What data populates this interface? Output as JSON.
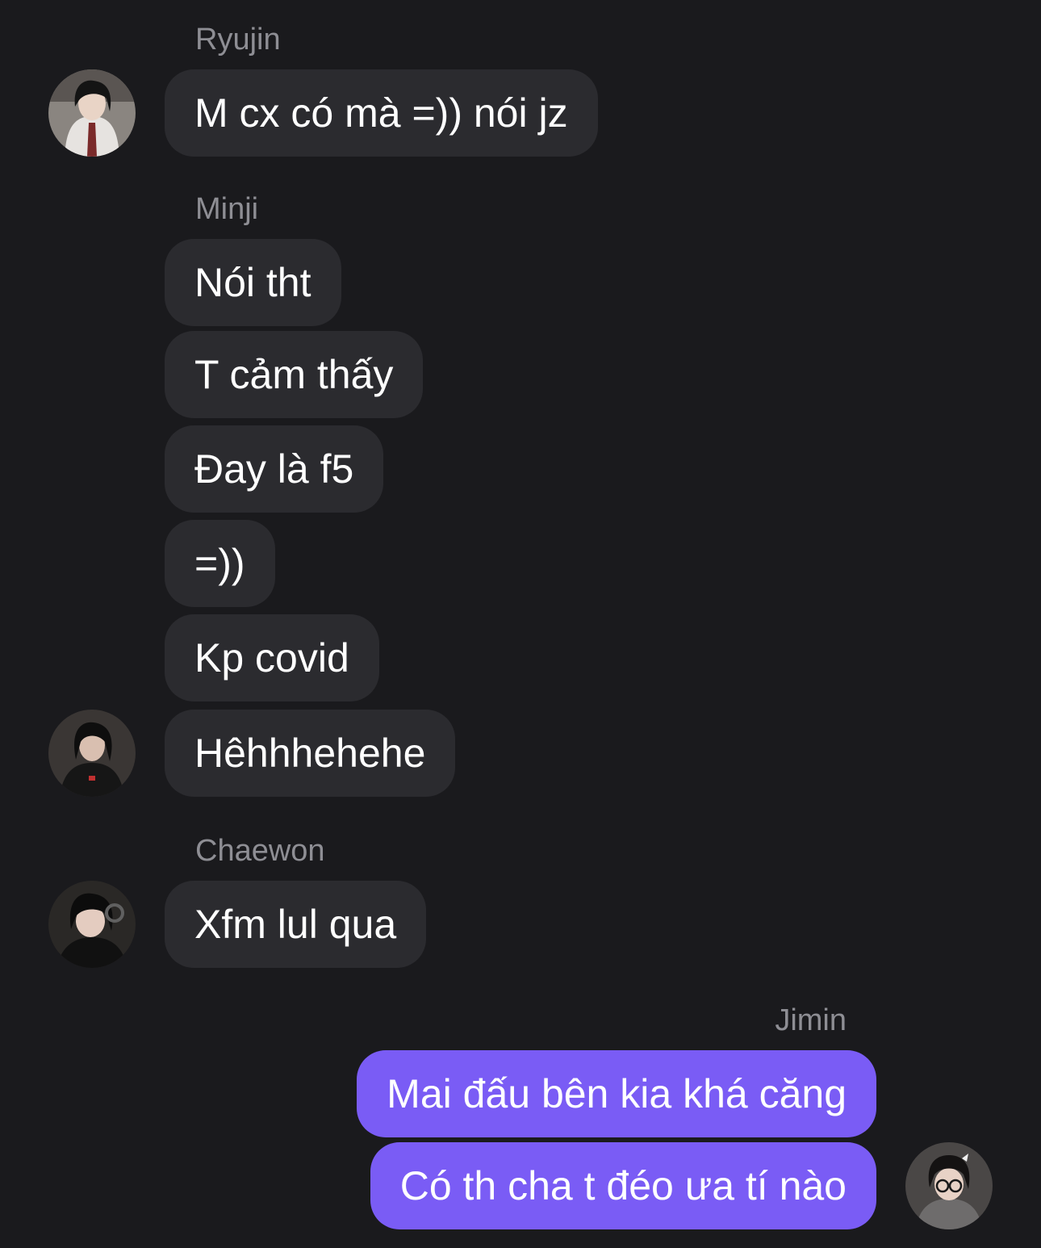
{
  "messages": {
    "group1": {
      "sender": "Ryujin",
      "avatar": "ryujin-avatar",
      "bubbles": [
        "M cx có mà =)) nói jz"
      ]
    },
    "group2": {
      "sender": "Minji",
      "avatar": "minji-avatar",
      "bubbles": [
        "Nói tht",
        "T cảm thấy",
        "Đay là f5",
        "=))",
        "Kp covid",
        "Hêhhhehehe"
      ]
    },
    "group3": {
      "sender": "Chaewon",
      "avatar": "chaewon-avatar",
      "bubbles": [
        "Xfm lul qua"
      ]
    },
    "group4": {
      "sender": "Jimin",
      "avatar": "jimin-avatar",
      "bubbles": [
        "Mai đấu bên kia khá căng",
        "Có th cha t đéo ưa tí nào"
      ]
    }
  },
  "colors": {
    "background": "#1a1a1d",
    "incoming_bubble": "#2b2b2f",
    "outgoing_bubble": "#7a5cf5",
    "sender_name": "#8e8e94",
    "message_text": "#ffffff"
  }
}
